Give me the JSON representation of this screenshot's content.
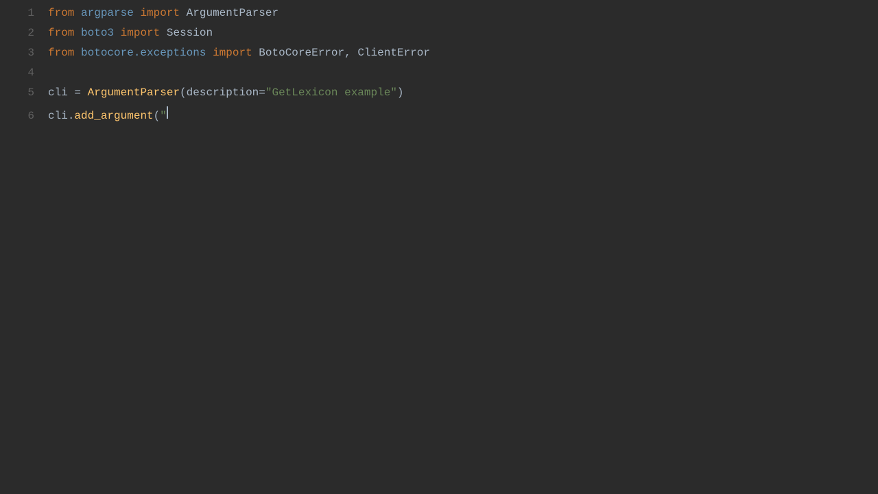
{
  "editor": {
    "background": "#2b2b2b",
    "lines": [
      {
        "number": 1,
        "tokens": [
          {
            "type": "keyword",
            "text": "from"
          },
          {
            "type": "space",
            "text": " "
          },
          {
            "type": "module",
            "text": "argparse"
          },
          {
            "type": "space",
            "text": " "
          },
          {
            "type": "keyword",
            "text": "import"
          },
          {
            "type": "space",
            "text": " "
          },
          {
            "type": "classname",
            "text": "ArgumentParser"
          }
        ]
      },
      {
        "number": 2,
        "tokens": [
          {
            "type": "keyword",
            "text": "from"
          },
          {
            "type": "space",
            "text": " "
          },
          {
            "type": "module",
            "text": "boto3"
          },
          {
            "type": "space",
            "text": " "
          },
          {
            "type": "keyword",
            "text": "import"
          },
          {
            "type": "space",
            "text": " "
          },
          {
            "type": "classname",
            "text": "Session"
          }
        ]
      },
      {
        "number": 3,
        "tokens": [
          {
            "type": "keyword",
            "text": "from"
          },
          {
            "type": "space",
            "text": " "
          },
          {
            "type": "module",
            "text": "botocore.exceptions"
          },
          {
            "type": "space",
            "text": " "
          },
          {
            "type": "keyword",
            "text": "import"
          },
          {
            "type": "space",
            "text": " "
          },
          {
            "type": "classname",
            "text": "BotoCoreError"
          },
          {
            "type": "plain",
            "text": ", "
          },
          {
            "type": "classname",
            "text": "ClientError"
          }
        ]
      },
      {
        "number": 4,
        "tokens": []
      },
      {
        "number": 5,
        "tokens": [
          {
            "type": "varname",
            "text": "cli"
          },
          {
            "type": "plain",
            "text": " = "
          },
          {
            "type": "funcname",
            "text": "ArgumentParser"
          },
          {
            "type": "plain",
            "text": "("
          },
          {
            "type": "plain",
            "text": "description="
          },
          {
            "type": "string",
            "text": "\"GetLexicon example\""
          },
          {
            "type": "plain",
            "text": ")"
          }
        ]
      },
      {
        "number": 6,
        "tokens": [
          {
            "type": "varname",
            "text": "cli"
          },
          {
            "type": "plain",
            "text": "."
          },
          {
            "type": "funcname",
            "text": "add_argument"
          },
          {
            "type": "plain",
            "text": "("
          },
          {
            "type": "string",
            "text": "\""
          },
          {
            "type": "cursor",
            "text": ""
          }
        ]
      }
    ]
  }
}
